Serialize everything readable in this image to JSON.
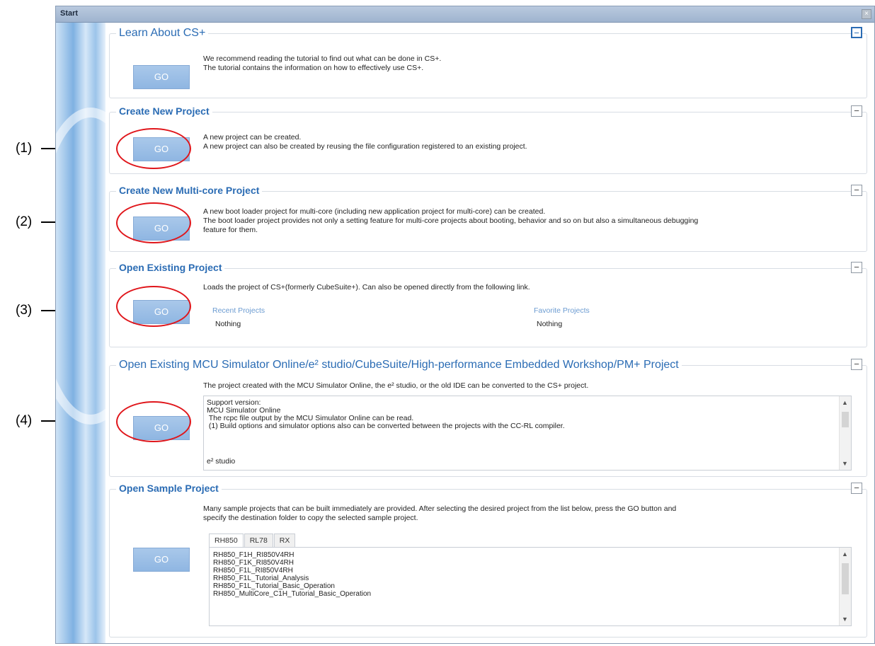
{
  "window": {
    "title": "Start"
  },
  "callouts": [
    "(1)",
    "(2)",
    "(3)",
    "(4)"
  ],
  "sections": {
    "learn": {
      "title": "Learn About CS+",
      "go": "GO",
      "desc": [
        "We recommend reading the tutorial to find out what can be done in CS+.",
        "The tutorial contains the information on how to effectively use CS+."
      ]
    },
    "new_project": {
      "title": "Create New Project",
      "go": "GO",
      "desc": [
        "A new project can be created.",
        "A new project can also be created by reusing the file configuration registered to an existing project."
      ]
    },
    "multicore": {
      "title": "Create New Multi-core Project",
      "go": "GO",
      "desc": [
        "A new boot loader project for multi-core (including new application project for multi-core) can be created.",
        "The boot loader project provides not only a setting feature for multi-core projects about booting, behavior and so on but also a simultaneous debugging",
        "feature for them."
      ]
    },
    "existing": {
      "title": "Open Existing Project",
      "go": "GO",
      "desc": "Loads the project of CS+(formerly CubeSuite+). Can also be opened directly from the following link.",
      "recent_label": "Recent Projects",
      "recent_value": "Nothing",
      "favorite_label": "Favorite Projects",
      "favorite_value": "Nothing"
    },
    "convert": {
      "title": "Open Existing MCU Simulator Online/e² studio/CubeSuite/High-performance Embedded Workshop/PM+ Project",
      "go": "GO",
      "desc": "The project created with the MCU Simulator Online, the e² studio, or the old IDE can be converted to the CS+ project.",
      "support_lines": [
        "Support version:",
        "MCU Simulator Online",
        " The rcpc file output by the MCU Simulator Online can be read.",
        " (1) Build options and simulator options also can be converted between the projects with the CC-RL compiler.",
        "",
        "e² studio"
      ]
    },
    "sample": {
      "title": "Open Sample Project",
      "go": "GO",
      "desc": [
        "Many sample projects that can be built immediately are provided. After selecting the desired project from the list below, press the GO button and",
        "specify the destination folder to copy the selected sample project."
      ],
      "tabs": [
        "RH850",
        "RL78",
        "RX"
      ],
      "items": [
        "RH850_F1H_RI850V4RH",
        "RH850_F1K_RI850V4RH",
        "RH850_F1L_RI850V4RH",
        "RH850_F1L_Tutorial_Analysis",
        "RH850_F1L_Tutorial_Basic_Operation",
        "RH850_MultiCore_C1H_Tutorial_Basic_Operation"
      ]
    }
  },
  "collapse_symbol": "−",
  "scroll": {
    "up": "▲",
    "down": "▼"
  },
  "close_symbol": "×"
}
